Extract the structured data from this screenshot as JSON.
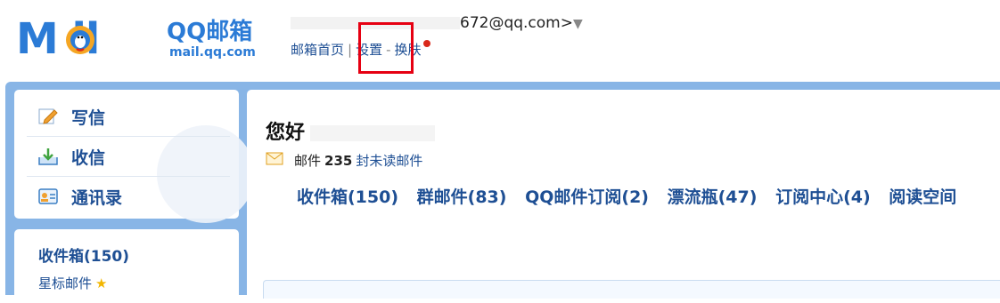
{
  "header": {
    "logo_mail": "M il",
    "logo_qq": "QQ邮箱",
    "logo_domain": "mail.qq.com",
    "account_suffix": "672@qq.com>",
    "nav": {
      "home": "邮箱首页",
      "settings": "设置",
      "skin": "换肤"
    }
  },
  "sidebar": {
    "actions": {
      "write": "写信",
      "receive": "收信",
      "contacts": "通讯录"
    },
    "folders": {
      "inbox": "收件箱(150)",
      "starred": "星标邮件"
    }
  },
  "main": {
    "greeting": "您好",
    "unread_prefix": "邮件",
    "unread_count": "235",
    "unread_link": "封未读邮件",
    "folder_links": [
      "收件箱(150)",
      "群邮件(83)",
      "QQ邮件订阅(2)",
      "漂流瓶(47)",
      "订阅中心(4)",
      "阅读空间"
    ]
  },
  "colors": {
    "brand_blue": "#2b7bd6",
    "link_blue": "#1e4f94",
    "frame_blue": "#88b5e6",
    "highlight_red": "#e60012"
  }
}
